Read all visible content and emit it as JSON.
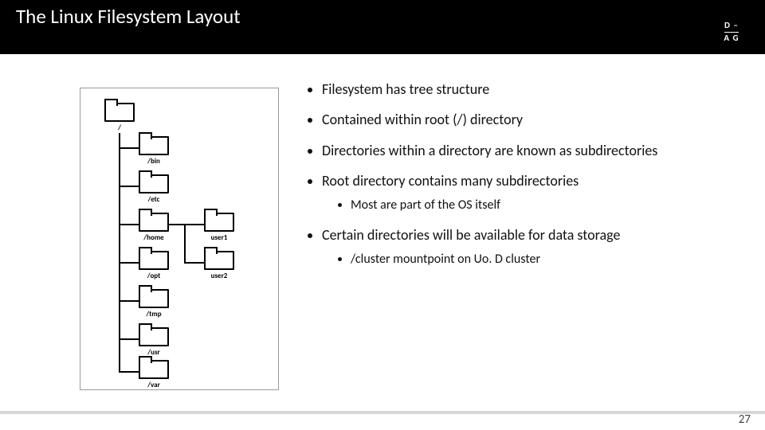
{
  "title": "The Linux Filesystem Layout",
  "logo": {
    "top": "D –",
    "bottom": "A G"
  },
  "tree": {
    "root": "/",
    "level1": [
      "/bin",
      "/etc",
      "/home",
      "/opt",
      "/tmp",
      "/usr",
      "/var"
    ],
    "home_children": [
      "user1",
      "user2"
    ]
  },
  "bullets": [
    {
      "text": "Filesystem has tree structure"
    },
    {
      "text": "Contained within root (/) directory"
    },
    {
      "text": "Directories within a directory are known as subdirectories"
    },
    {
      "text": "Root directory contains many subdirectories",
      "sub": [
        "Most are part of the OS itself"
      ]
    },
    {
      "text": "Certain directories will be available for data storage",
      "sub": [
        "/cluster mountpoint on Uo. D cluster"
      ]
    }
  ],
  "page_number": "27"
}
